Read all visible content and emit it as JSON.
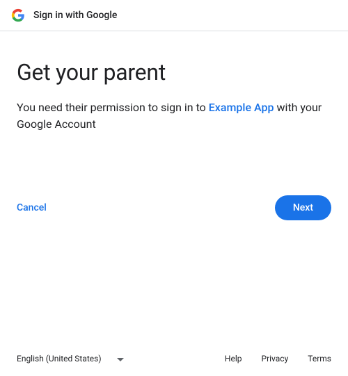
{
  "header": {
    "title": "Sign in with Google"
  },
  "main": {
    "heading": "Get your parent",
    "description_prefix": "You need their permission to sign in to ",
    "app_name": "Example App",
    "description_suffix": " with your Google Account"
  },
  "actions": {
    "cancel_label": "Cancel",
    "next_label": "Next"
  },
  "footer": {
    "language": "English (United States)",
    "links": {
      "help": "Help",
      "privacy": "Privacy",
      "terms": "Terms"
    }
  }
}
